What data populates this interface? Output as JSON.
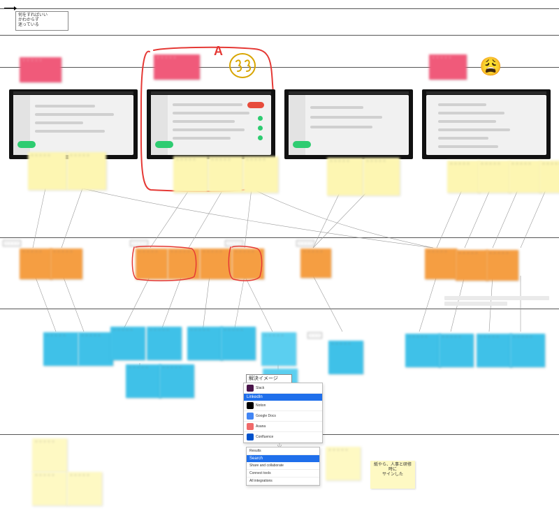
{
  "header": {
    "box": "何をすればいい\nかわからず\n迷っている"
  },
  "annotation": {
    "a_label": "A"
  },
  "emoji": {
    "weary": "😩"
  },
  "pink_notes": {
    "p1": "・・・・・",
    "p2": "・・・・・",
    "p3": "・・・・・"
  },
  "yellow_row1": {
    "n1": "・・・・・",
    "n2": "・・・・・",
    "n3": "・・・・・",
    "n4": "・・・・・",
    "n5": "・・・・・",
    "n6": "・・・・・",
    "n7": "・・・・・",
    "n8": "・・・・・",
    "n9": "・・・・・",
    "n10": "・・・・・",
    "n11": "・・・・・"
  },
  "orange_row": {
    "tag1": "・・・・",
    "tag2": "・・・・",
    "tag3": "・・・・",
    "tag4": "・・・・",
    "o1": "・・・・・",
    "o2": "・・・・・",
    "o3": "・・・・・",
    "o4": "・・・・・",
    "o5": "・・・・・",
    "o6": "・・・・・",
    "o7": "・・・・・",
    "o8": "・・・・・",
    "o9": "・・・・・",
    "o10": "・・・・・"
  },
  "blue_row": {
    "b1": "・・・・・",
    "b2": "・・・・・",
    "b3": "・・・・・",
    "b4": "・・・・・",
    "b5": "・・・・・",
    "b6": "・・・・・",
    "b7": "・・・・・",
    "b8": "・・・・・",
    "b9": "・・・・・",
    "b10": "・・・・・",
    "b11": "・・・・・",
    "b12": "・・・・・",
    "b13": "・・・・・",
    "b14": "・・・・・",
    "side_label": "・・・"
  },
  "yellow_row_bottom": {
    "y1": "・・・・・",
    "y2": "・・・・・",
    "y3": "・・・・・",
    "y4": "・・・・・",
    "y5": "紙やら、人事と研修時に\nサインした"
  },
  "panel": {
    "title": "解決イメージ",
    "app1": {
      "name": "Slack"
    },
    "app2": {
      "name": "LinkedIn"
    },
    "app3": {
      "name": "Notion"
    },
    "app4": {
      "name": "Google Docs"
    },
    "app5": {
      "name": "Asana"
    },
    "app6": {
      "name": "Confluence"
    }
  },
  "panel2": {
    "hl": "Search",
    "r1": "Results",
    "r2": "Share and collaborate",
    "r3": "Connect tools",
    "r4": "All integrations"
  },
  "lanes": {
    "l0": 12,
    "l1": 50,
    "l2": 96,
    "l3": 340,
    "l4": 442,
    "l5": 622
  }
}
